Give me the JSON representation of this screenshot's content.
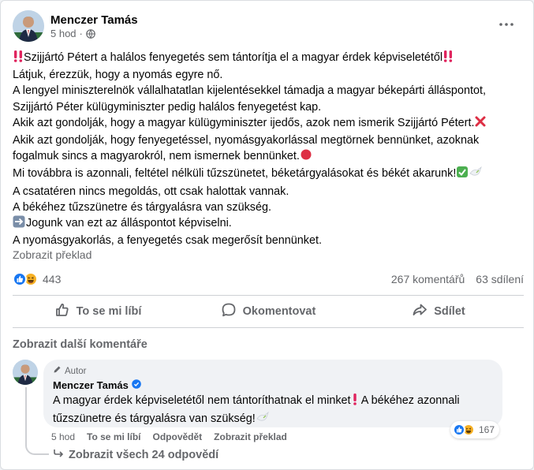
{
  "post": {
    "author": "Menczer Tamás",
    "time": "5 hod",
    "lines": [
      "Szijjártó Pétert a halálos fenyegetés sem tántorítja el a magyar érdek képviseletétől",
      "Látjuk, érezzük, hogy a nyomás egyre nő.",
      "A lengyel miniszterelnök vállalhatatlan kijelentésekkel támadja a magyar békepárti álláspontot,",
      "Szijjártó Péter külügyminiszter pedig halálos fenyegetést kap.",
      "Akik azt gondolják, hogy a magyar külügyminiszter ijedős, azok nem ismerik Szijjártó Pétert.",
      "Akik azt gondolják, hogy fenyegetéssel, nyomásgyakorlással megtörnek bennünket, azoknak",
      "fogalmuk sincs a magyarokról, nem ismernek bennünket.",
      "Mi továbbra is azonnali, feltétel nélküli tűzszünetet, béketárgyalásokat és békét akarunk!",
      "A csatatéren nincs megoldás, ott csak halottak vannak.",
      "A békéhez tűzszünetre és tárgyalásra van szükség.",
      "Jogunk van ezt az álláspontot képviselni.",
      "A nyomásgyakorlás, a fenyegetés csak megerősít bennünket."
    ],
    "translate": "Zobrazit překlad",
    "reactions_count": "443",
    "comments_count": "267 komentářů",
    "shares_count": "63 sdílení"
  },
  "actions": {
    "like": "To se mi líbí",
    "comment": "Okomentovat",
    "share": "Sdílet"
  },
  "more_comments": "Zobrazit další komentáře",
  "comment": {
    "badge": "Autor",
    "author": "Menczer Tamás",
    "line1": "A magyar érdek képviseletétől nem tántoríthatnak el minket",
    "line1_tail": "A békéhez azonnali",
    "line2": "tűzszünetre és tárgyalásra van szükség!",
    "time": "5 hod",
    "like": "To se mi líbí",
    "reply": "Odpovědět",
    "translate": "Zobrazit překlad",
    "reactions_count": "167"
  },
  "view_replies": "Zobrazit všech 24 odpovědí",
  "colors": {
    "accent": "#1877f2",
    "text_secondary": "#65676b",
    "emoji_red": "#e0245e",
    "check_green": "#4caf50"
  },
  "icons": [
    "globe-icon",
    "more-icon",
    "double-exclamation-icon",
    "cross-mark-icon",
    "red-circle-icon",
    "check-mark-icon",
    "dove-icon",
    "right-arrow-icon",
    "like-icon",
    "comment-icon",
    "share-icon",
    "pencil-icon",
    "verified-icon",
    "exclamation-icon",
    "haha-icon",
    "reply-arrow-icon"
  ]
}
